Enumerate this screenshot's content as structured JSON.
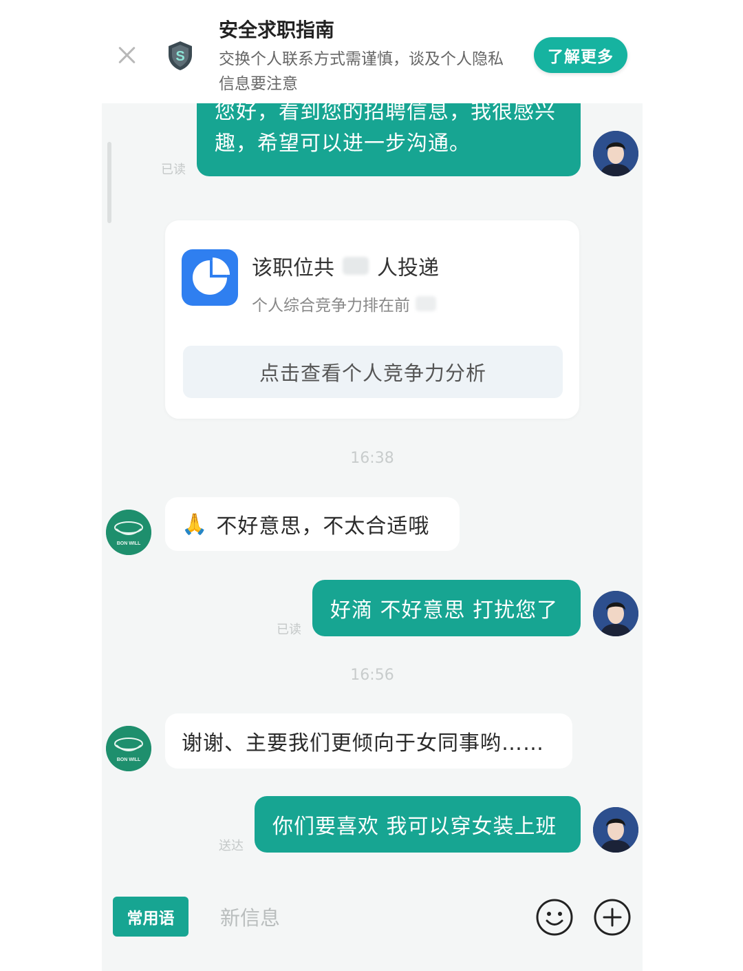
{
  "banner": {
    "title": "安全求职指南",
    "description": "交换个人联系方式需谨慎，谈及个人隐私信息要注意",
    "learn_more": "了解更多",
    "close_icon": "close-icon",
    "shield_icon": "shield-icon"
  },
  "messages": {
    "m1_line1": "您好，看到您的招聘信息，我很感兴",
    "m1_line2": "趣，希望可以进一步沟通。",
    "m1_status": "已读",
    "card_title_prefix": "该职位共",
    "card_title_suffix": "人投递",
    "card_subtitle": "个人综合竞争力排在前",
    "card_button": "点击查看个人竞争力分析",
    "time1": "16:38",
    "m2_emoji": "🙏",
    "m2_text": "不好意思，不太合适哦",
    "m3_text": "好滴 不好意思 打扰您了",
    "m3_status": "已读",
    "time2": "16:56",
    "m4_text": "谢谢、主要我们更倾向于女同事哟……",
    "m5_text": "你们要喜欢 我可以穿女装上班",
    "m5_status": "送达"
  },
  "company": {
    "logo_text": "BON WILL"
  },
  "input_bar": {
    "phrases_label": "常用语",
    "placeholder": "新信息",
    "emoji_icon": "smiley-icon",
    "plus_icon": "plus-icon"
  },
  "colors": {
    "accent": "#17a592",
    "chat_bg": "#f4f6f6",
    "card_icon": "#2f7ff0"
  }
}
